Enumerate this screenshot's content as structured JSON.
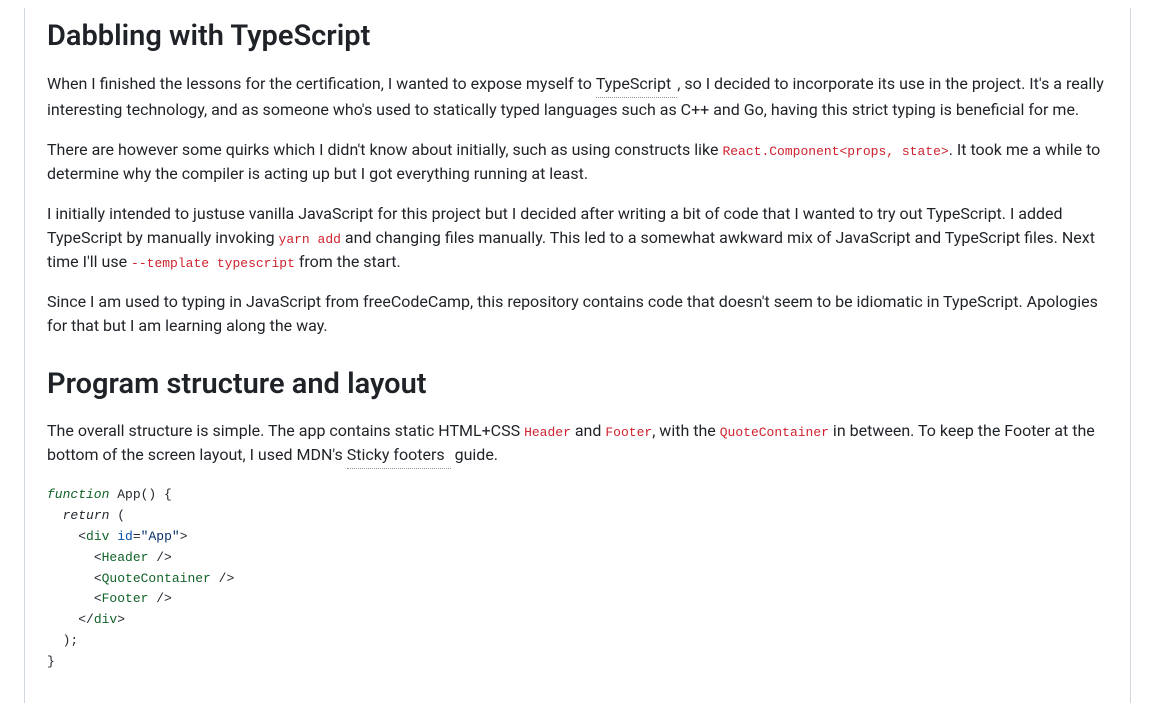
{
  "section1": {
    "heading": "Dabbling with TypeScript",
    "p1_pre": "When I finished the lessons for the certification, I wanted to expose myself to ",
    "p1_link_text": "TypeScript",
    "p1_post": ", so I decided to incorporate its use in the project. It's a really interesting technology, and as someone who's used to statically typed languages such as C++ and Go, having this strict typing is beneficial for me.",
    "p2_pre": "There are however some quirks which I didn't know about initially, such as using constructs like ",
    "p2_code": "React.Component<props, state>",
    "p2_post": ". It took me a while to determine why the compiler is acting up but I got everything running at least.",
    "p3_pre": "I initially intended to justuse vanilla JavaScript for this project but I decided after writing a bit of code that I wanted to try out TypeScript. I added TypeScript by manually invoking ",
    "p3_code1": "yarn add",
    "p3_mid": " and changing files manually. This led to a somewhat awkward mix of JavaScript and TypeScript files. Next time I'll use ",
    "p3_code2": "--template typescript",
    "p3_post": " from the start.",
    "p4": "Since I am used to typing in JavaScript from freeCodeCamp, this repository contains code that doesn't seem to be idiomatic in TypeScript. Apologies for that but I am learning along the way."
  },
  "section2": {
    "heading": "Program structure and layout",
    "p1_pre": "The overall structure is simple. The app contains static HTML+CSS ",
    "p1_code1": "Header",
    "p1_mid1": " and ",
    "p1_code2": "Footer",
    "p1_mid2": ", with the ",
    "p1_code3": "QuoteContainer",
    "p1_mid3": " in between. To keep the Footer at the bottom of the screen layout, I used MDN's ",
    "p1_link_text": "Sticky footers",
    "p1_post": " guide."
  },
  "code": {
    "kw_function": "function",
    "fn_name": " App() {",
    "indent1": "  ",
    "kw_return": "return",
    "paren_open": " (",
    "indent2": "    ",
    "lt": "<",
    "gt": ">",
    "slash_gt": " />",
    "close_tag_open": "</",
    "tag_div": "div",
    "attr_id": "id",
    "eq": "=",
    "str_app": "\"App\"",
    "indent3": "      ",
    "tag_header": "Header",
    "tag_quote": "QuoteContainer",
    "tag_footer": "Footer",
    "paren_close": "  );",
    "brace_close": "}"
  }
}
